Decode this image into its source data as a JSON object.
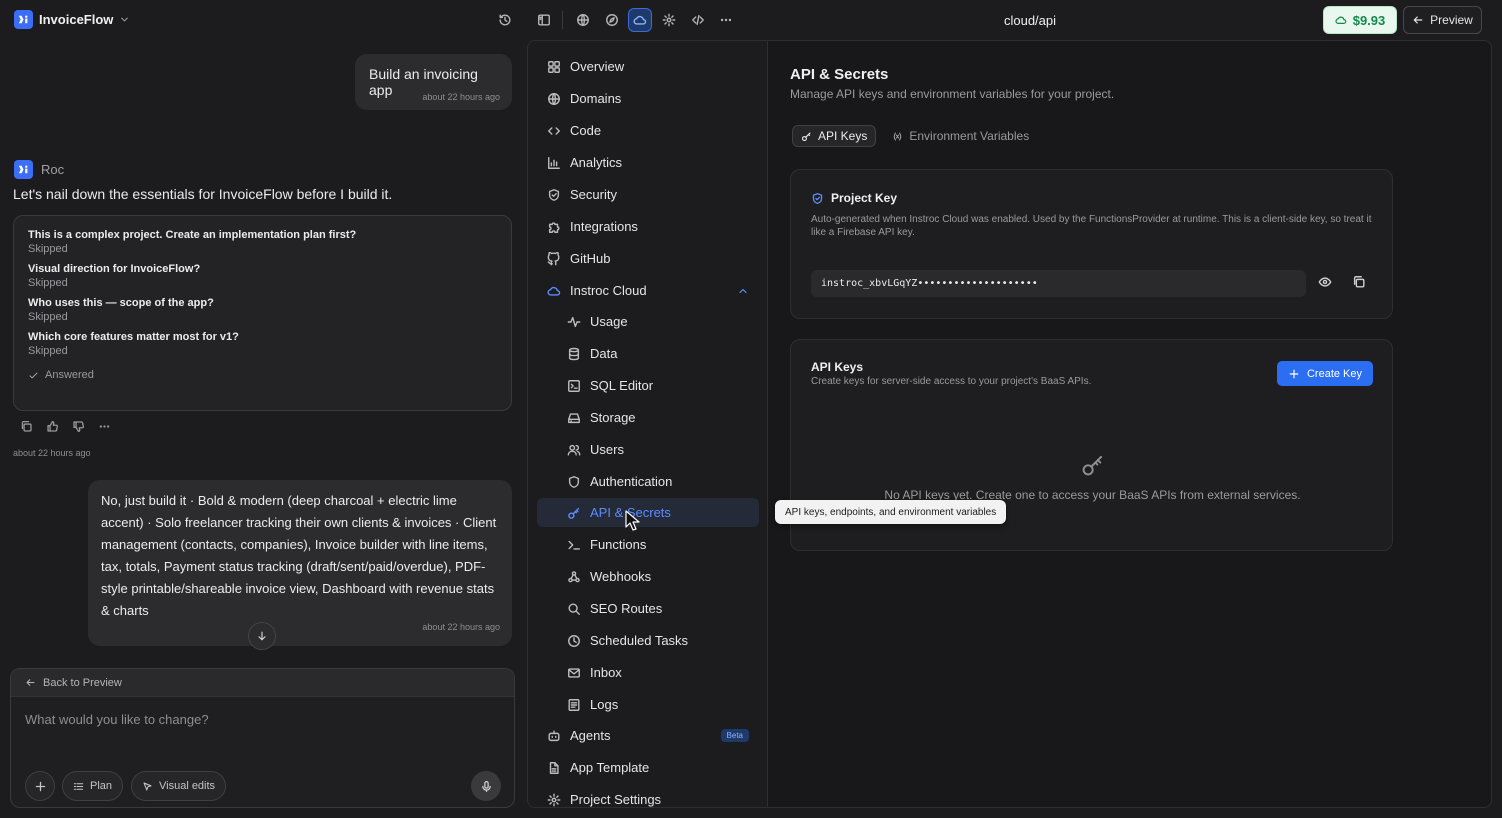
{
  "app": {
    "name": "InvoiceFlow",
    "logo_text": "ꟷ"
  },
  "topbar": {
    "url_title": "cloud/api",
    "credit": "$9.93",
    "preview_label": "Preview"
  },
  "chat": {
    "user_msg_1": {
      "text": "Build an invoicing app",
      "time": "about 22 hours ago"
    },
    "assistant_name": "Roc",
    "assistant_msg": "Let's nail down the essentials for InvoiceFlow before I build it.",
    "questions": [
      {
        "title": "This is a complex project. Create an implementation plan first?",
        "status": "Skipped"
      },
      {
        "title": "Visual direction for InvoiceFlow?",
        "status": "Skipped"
      },
      {
        "title": "Who uses this — scope of the app?",
        "status": "Skipped"
      },
      {
        "title": "Which core features matter most for v1?",
        "status": "Skipped"
      }
    ],
    "answered_label": "Answered",
    "assistant_time": "about 22 hours ago",
    "user_msg_2": {
      "text": "No, just build it · Bold & modern (deep charcoal + electric lime accent) · Solo freelancer tracking their own clients & invoices · Client management (contacts, companies), Invoice builder with line items, tax, totals, Payment status tracking (draft/sent/paid/overdue), PDF-style printable/shareable invoice view, Dashboard with revenue stats & charts",
      "time": "about 22 hours ago"
    },
    "composer": {
      "back_label": "Back to Preview",
      "placeholder": "What would you like to change?",
      "plan_label": "Plan",
      "visual_edits_label": "Visual edits"
    }
  },
  "nav": {
    "items": [
      {
        "label": "Overview",
        "icon": "grid-icon"
      },
      {
        "label": "Domains",
        "icon": "globe-icon"
      },
      {
        "label": "Code",
        "icon": "code-icon"
      },
      {
        "label": "Analytics",
        "icon": "bar-chart-icon"
      },
      {
        "label": "Security",
        "icon": "shield-icon"
      },
      {
        "label": "Integrations",
        "icon": "puzzle-icon"
      },
      {
        "label": "GitHub",
        "icon": "github-icon"
      },
      {
        "label": "Instroc Cloud",
        "icon": "cloud-icon"
      }
    ],
    "cloud_items": [
      {
        "label": "Usage",
        "icon": "activity-icon"
      },
      {
        "label": "Data",
        "icon": "database-icon"
      },
      {
        "label": "SQL Editor",
        "icon": "terminal-square-icon"
      },
      {
        "label": "Storage",
        "icon": "hard-drive-icon"
      },
      {
        "label": "Users",
        "icon": "users-icon"
      },
      {
        "label": "Authentication",
        "icon": "shield-icon"
      },
      {
        "label": "API & Secrets",
        "icon": "key-icon"
      },
      {
        "label": "Functions",
        "icon": "terminal-icon"
      },
      {
        "label": "Webhooks",
        "icon": "webhook-icon"
      },
      {
        "label": "SEO Routes",
        "icon": "search-icon"
      },
      {
        "label": "Scheduled Tasks",
        "icon": "clock-icon"
      },
      {
        "label": "Inbox",
        "icon": "mail-icon"
      },
      {
        "label": "Logs",
        "icon": "logs-icon"
      }
    ],
    "bottom_items": [
      {
        "label": "Agents",
        "icon": "bot-icon",
        "badge": "Beta"
      },
      {
        "label": "App Template",
        "icon": "file-icon"
      },
      {
        "label": "Project Settings",
        "icon": "gear-icon"
      }
    ],
    "tooltip": "API keys, endpoints, and environment variables"
  },
  "content": {
    "title": "API & Secrets",
    "subtitle": "Manage API keys and environment variables for your project.",
    "tabs": [
      {
        "label": "API Keys",
        "active": true
      },
      {
        "label": "Environment Variables",
        "active": false
      }
    ],
    "project_key": {
      "title": "Project Key",
      "description": "Auto-generated when Instroc Cloud was enabled. Used by the FunctionsProvider at runtime. This is a client-side key, so treat it like a Firebase API key.",
      "value": "instroc_xbvLGqYZ••••••••••••••••••••"
    },
    "api_keys": {
      "title": "API Keys",
      "description": "Create keys for server-side access to your project's BaaS APIs.",
      "create_label": "Create Key",
      "empty_text": "No API keys yet. Create one to access your BaaS APIs from external services."
    }
  },
  "colors": {
    "accent": "#2b6ef2",
    "credit_green": "#13894a",
    "background": "#1c1c1e"
  }
}
